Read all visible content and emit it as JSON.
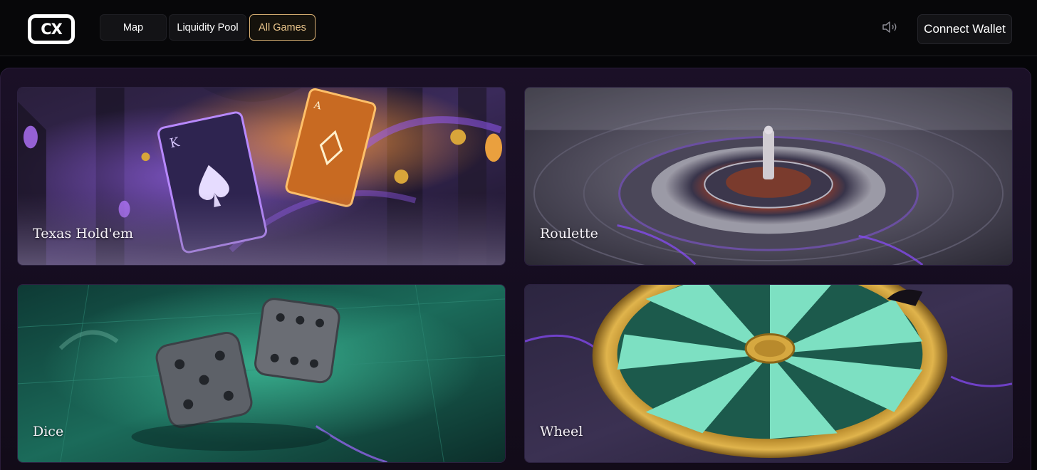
{
  "header": {
    "logo_text": "CX",
    "nav": [
      {
        "label": "Map",
        "active": false
      },
      {
        "label": "Liquidity Pool",
        "active": false
      },
      {
        "label": "All Games",
        "active": true
      }
    ],
    "sound_icon": "speaker-icon",
    "connect_wallet_label": "Connect Wallet"
  },
  "games": [
    {
      "title": "Texas Hold'em",
      "theme": "purple-cards"
    },
    {
      "title": "Roulette",
      "theme": "grey-stone-roulette"
    },
    {
      "title": "Dice",
      "theme": "green-dice"
    },
    {
      "title": "Wheel",
      "theme": "gold-green-wheel"
    }
  ],
  "colors": {
    "accent_gold": "#d9b073",
    "panel_purple": "#1b1027",
    "header_bg": "#070709"
  }
}
